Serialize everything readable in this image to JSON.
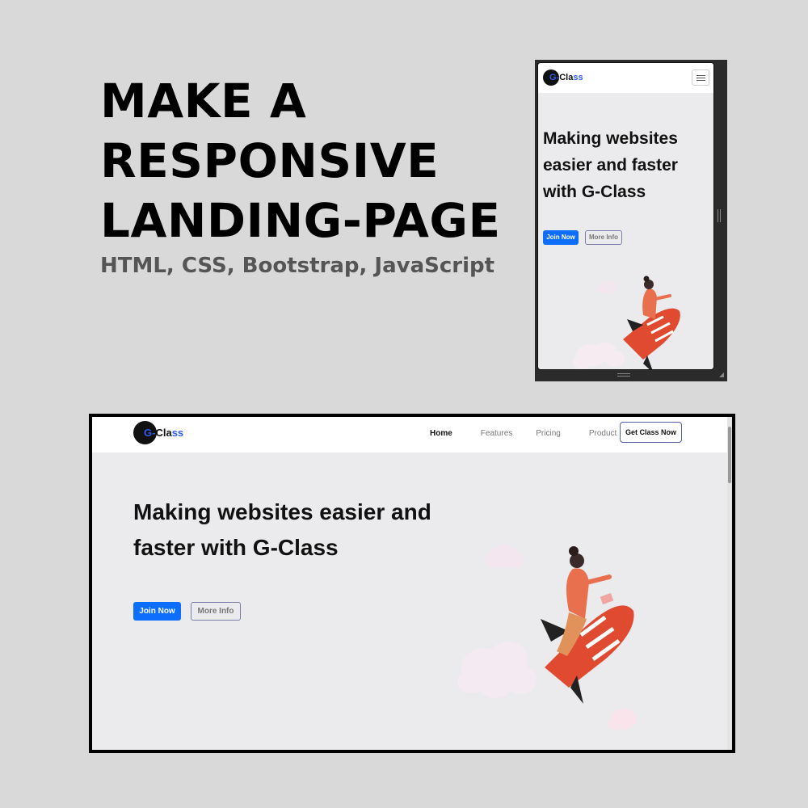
{
  "headline": {
    "line1": "MAKE A",
    "line2": "RESPONSIVE",
    "line3": "LANDING-PAGE",
    "subtitle": "HTML, CSS, Bootstrap, JavaScript"
  },
  "brand": {
    "logo_prefix": "G-",
    "logo_plain": "Cla",
    "logo_blue": "ss"
  },
  "mobile": {
    "hero_title": "Making websites easier and faster with G-Class",
    "join_label": "Join Now",
    "more_label": "More Info"
  },
  "desktop": {
    "nav": {
      "home": "Home",
      "features": "Features",
      "pricing": "Pricing",
      "product": "Product",
      "cta": "Get Class Now"
    },
    "hero_title": "Making websites easier and faster with G-Class",
    "join_label": "Join Now",
    "more_label": "More Info"
  },
  "colors": {
    "background": "#d9d9d9",
    "hero_bg": "#ebebed",
    "primary": "#0d6efd",
    "rocket": "#e04a30"
  },
  "icons": [
    "hamburger-menu-icon",
    "rocket-girl-illustration",
    "cloud-icon"
  ]
}
